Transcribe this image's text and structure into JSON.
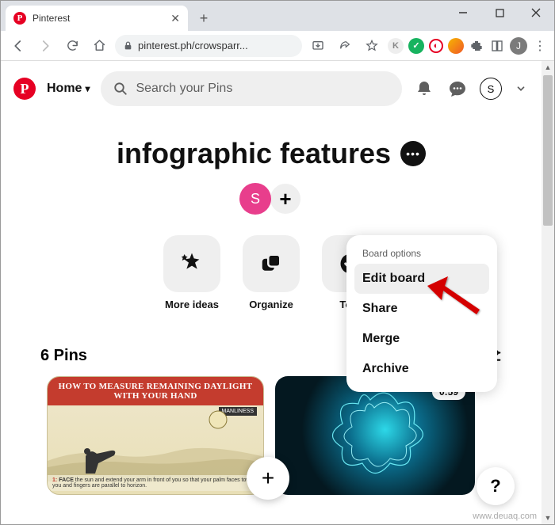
{
  "browser": {
    "tab_title": "Pinterest",
    "url": "pinterest.ph/crowsparr...",
    "profile_initial": "J"
  },
  "header": {
    "home_label": "Home",
    "search_placeholder": "Search your Pins",
    "profile_initial": "S"
  },
  "board": {
    "title": "infographic features",
    "collaborator_initial": "S"
  },
  "actions": {
    "more_ideas": "More ideas",
    "organize": "Organize",
    "todo": "To-d"
  },
  "popup": {
    "title": "Board options",
    "items": [
      "Edit board",
      "Share",
      "Merge",
      "Archive"
    ]
  },
  "pins": {
    "count_label": "6 Pins",
    "pin1_title_line1": "HOW TO MEASURE REMAINING DAYLIGHT",
    "pin1_title_line2": "WITH YOUR HAND",
    "pin1_ribbon": "MANLINESS",
    "pin1_caption_num": "1:",
    "pin1_caption_bold": "FACE",
    "pin1_caption_rest": " the sun and extend your arm in front of you so that your palm faces toward you and fingers are parallel to horizon.",
    "pin2_badge": "0:59"
  },
  "help_label": "?",
  "watermark": "www.deuaq.com"
}
